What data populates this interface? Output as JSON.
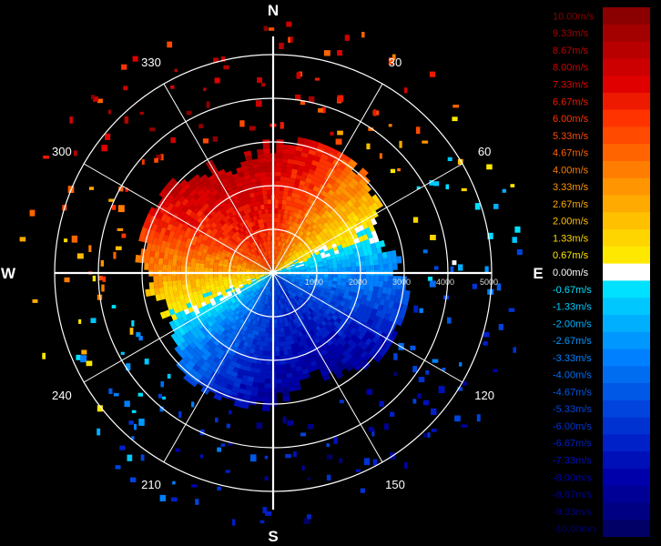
{
  "chart_data": {
    "type": "heatmap",
    "subtype": "polar radial velocity (PPI)",
    "compass": {
      "N": "N",
      "E": "E",
      "S": "S",
      "W": "W"
    },
    "azimuth_labels": [
      "30",
      "60",
      "120",
      "150",
      "210",
      "240",
      "300",
      "330"
    ],
    "range_labels": [
      "1000",
      "2000",
      "3000",
      "4000",
      "5000"
    ],
    "range_rings": [
      1000,
      2000,
      3000,
      4000,
      5000
    ],
    "max_range": 5000,
    "velocity_range": [
      -10.0,
      10.0
    ],
    "zero_line_azimuth_deg": 68,
    "colorbar": {
      "labels": [
        "10.00m/s",
        "9.33m/s",
        "8.67m/s",
        "8.00m/s",
        "7.33m/s",
        "6.67m/s",
        "6.00m/s",
        "5.33m/s",
        "4.67m/s",
        "4.00m/s",
        "3.33m/s",
        "2.67m/s",
        "2.00m/s",
        "1.33m/s",
        "0.67m/s",
        "0.00m/s",
        "-0.67m/s",
        "-1.33m/s",
        "-2.00m/s",
        "-2.67m/s",
        "-3.33m/s",
        "-4.00m/s",
        "-4.67m/s",
        "-5.33m/s",
        "-6.00m/s",
        "-6.67m/s",
        "-7.33m/s",
        "-8.00m/s",
        "-8.67m/s",
        "-9.33m/s",
        "-10.00m/s"
      ],
      "colors": [
        "#8b0000",
        "#a30000",
        "#b80000",
        "#cc0000",
        "#e00000",
        "#ee1a00",
        "#ff3300",
        "#ff4a00",
        "#ff6400",
        "#ff7d00",
        "#ff9500",
        "#ffaa00",
        "#ffc000",
        "#ffd500",
        "#ffe800",
        "#ffffff",
        "#00e0ff",
        "#00c8ff",
        "#00b0ff",
        "#0098ff",
        "#0080ff",
        "#006cf0",
        "#0058e6",
        "#0044dd",
        "#0032d2",
        "#0020c8",
        "#0010b8",
        "#0000aa",
        "#000096",
        "#000082",
        "#000066"
      ]
    }
  }
}
